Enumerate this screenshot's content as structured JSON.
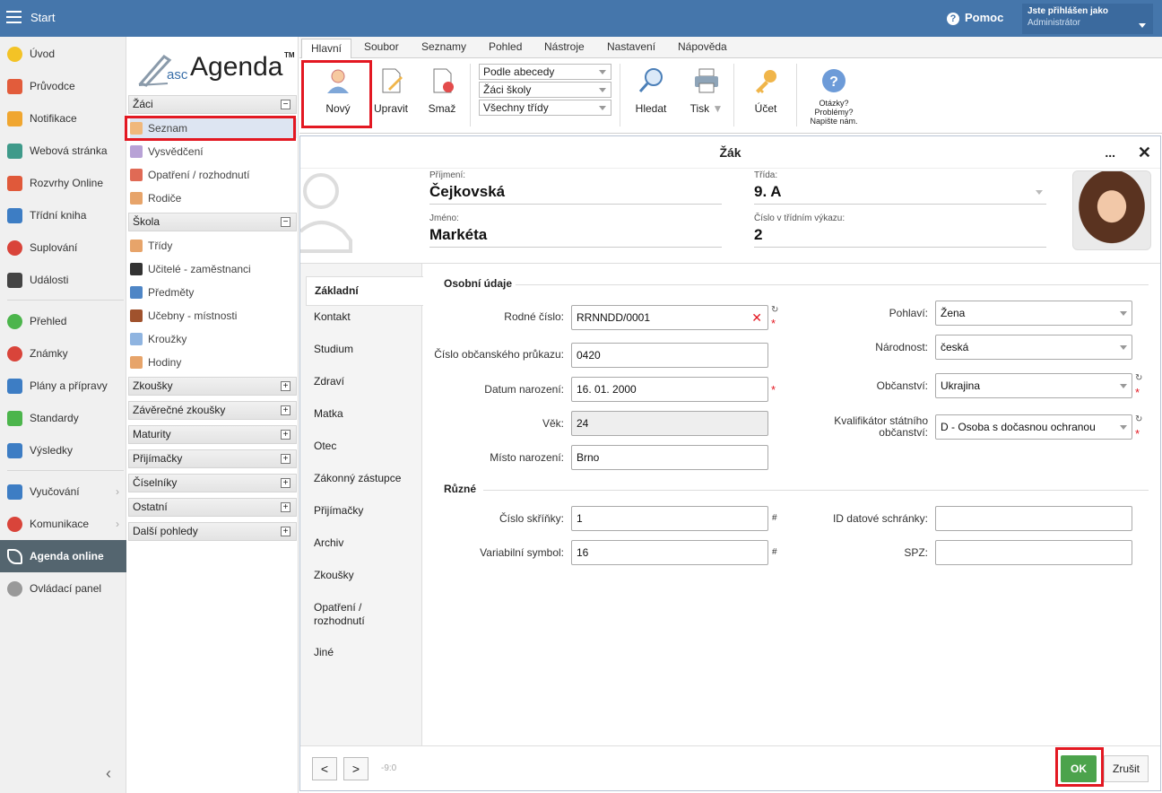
{
  "topbar": {
    "start": "Start",
    "help": "Pomoc",
    "user_line1": "Jste přihlášen jako",
    "user_line2": "Administrátor"
  },
  "sidebar": {
    "items": [
      "Úvod",
      "Průvodce",
      "Notifikace",
      "Webová stránka",
      "Rozvrhy Online",
      "Třídní kniha",
      "Suplování",
      "Události",
      "Přehled",
      "Známky",
      "Plány a přípravy",
      "Standardy",
      "Výsledky",
      "Vyučování",
      "Komunikace",
      "Agenda online",
      "Ovládací panel"
    ]
  },
  "tree": {
    "logo_asc": "asc",
    "logo_agenda": "Agenda",
    "logo_tm": "TM",
    "g_zaci": "Žáci",
    "zaci": [
      "Seznam",
      "Vysvědčení",
      "Opatření / rozhodnutí",
      "Rodiče"
    ],
    "g_skola": "Škola",
    "skola": [
      "Třídy",
      "Učitelé - zaměstnanci",
      "Předměty",
      "Učebny - místnosti",
      "Kroužky",
      "Hodiny"
    ],
    "groups": [
      "Zkoušky",
      "Závěrečné zkoušky",
      "Maturity",
      "Přijímačky",
      "Číselníky",
      "Ostatní",
      "Další pohledy"
    ]
  },
  "menu": [
    "Hlavní",
    "Soubor",
    "Seznamy",
    "Pohled",
    "Nástroje",
    "Nastavení",
    "Nápověda"
  ],
  "ribbon": {
    "novy": "Nový",
    "upravit": "Upravit",
    "smaz": "Smaž",
    "sel1": "Podle abecedy",
    "sel2": "Žáci školy",
    "sel3": "Všechny třídy",
    "hledat": "Hledat",
    "tisk": "Tisk",
    "ucet": "Účet",
    "q1": "Otázky?",
    "q2": "Problémy?",
    "q3": "Napište nám."
  },
  "dialog": {
    "title": "Žák",
    "dots": "...",
    "close": "✕",
    "prijmeni_lbl": "Příjmení:",
    "prijmeni": "Čejkovská",
    "jmeno_lbl": "Jméno:",
    "jmeno": "Markéta",
    "trida_lbl": "Třída:",
    "trida": "9. A",
    "cislo_lbl": "Číslo v třídním výkazu:",
    "cislo": "2",
    "tabs": [
      "Základní",
      "Kontakt",
      "Studium",
      "Zdraví",
      "Matka",
      "Otec",
      "Zákonný zástupce",
      "Přijímačky",
      "Archiv",
      "Zkoušky",
      "Opatření / rozhodnutí",
      "Jiné"
    ],
    "sect1": "Osobní údaje",
    "sect2": "Různé",
    "f_rc_lbl": "Rodné číslo:",
    "f_rc": "RRNNDD/0001",
    "f_op_lbl": "Číslo občanského průkazu:",
    "f_op": "0420",
    "f_dn_lbl": "Datum narození:",
    "f_dn": "16. 01. 2000",
    "f_vek_lbl": "Věk:",
    "f_vek": "24",
    "f_mn_lbl": "Místo narození:",
    "f_mn": "Brno",
    "f_poh_lbl": "Pohlaví:",
    "f_poh": "Žena",
    "f_nar_lbl": "Národnost:",
    "f_nar": "česká",
    "f_obc_lbl": "Občanství:",
    "f_obc": "Ukrajina",
    "f_kval_lbl1": "Kvalifikátor státního",
    "f_kval_lbl2": "občanství:",
    "f_kval": "D - Osoba s dočasnou ochranou",
    "f_skr_lbl": "Číslo skříňky:",
    "f_skr": "1",
    "f_vs_lbl": "Variabilní symbol:",
    "f_vs": "16",
    "f_ids_lbl": "ID datové schránky:",
    "f_ids": "",
    "f_spz_lbl": "SPZ:",
    "f_spz": "",
    "counter": "-9:0",
    "prev": "<",
    "next": ">",
    "ok": "OK",
    "cancel": "Zrušit",
    "asterisk": "*",
    "hash": "#",
    "refresh": "↻",
    "clear": "✕"
  },
  "colors": {
    "topbar": "#4576ab",
    "highlight": "#e31822",
    "ok": "#4ca34c",
    "sidebar_active": "#54656f"
  }
}
